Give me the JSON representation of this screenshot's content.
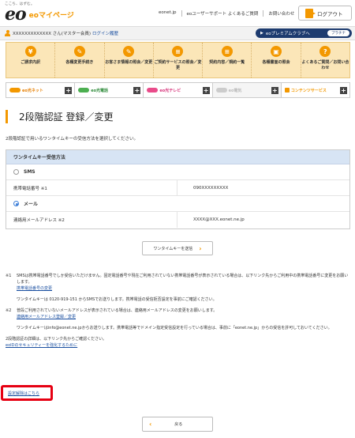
{
  "header": {
    "tagline": "ここち、はずむ。",
    "logo_text": "eo",
    "logo_sub": "eoマイページ",
    "links": [
      "eonet.jp",
      "eoユーザーサポート よくあるご質問",
      "お問い合わせ"
    ],
    "logout_label": "ログアウト"
  },
  "userbar": {
    "user_name": "XXXXXXXXXXXXX さん(マスター会員)",
    "history_link": "ログイン履歴",
    "premium_label": "eoプレミアムクラブへ",
    "premium_badge": "プラチナ"
  },
  "main_menu": [
    {
      "icon": "¥",
      "label": "ご請求内訳"
    },
    {
      "icon": "✎",
      "label": "各種変更手続き"
    },
    {
      "icon": "✎",
      "label": "お客さま情報の照会／変更"
    },
    {
      "icon": "≡",
      "label": "ご契約サービスの照会／変更"
    },
    {
      "icon": "≡",
      "label": "契約内容／規約一覧"
    },
    {
      "icon": "▣",
      "label": "各種書面の照会"
    },
    {
      "icon": "?",
      "label": "よくあるご質問／お問い合わせ"
    }
  ],
  "services": [
    {
      "label": "eo光ネット",
      "color": "#f39800",
      "text_color": "#e67e00"
    },
    {
      "label": "eo光電話",
      "color": "#4caf50",
      "text_color": "#2e8b3a"
    },
    {
      "label": "eo光テレビ",
      "color": "#e94b8a",
      "text_color": "#d6337a"
    },
    {
      "label": "eo電気",
      "color": "#cccccc",
      "text_color": "#bbbbbb"
    },
    {
      "label": "コンテンツサービス",
      "color": "#f39800",
      "text_color": "#f39800"
    }
  ],
  "page": {
    "title": "2段階認証 登録／変更",
    "intro": "2段階認証で用いるワンタイムキーの受信方法を選択してください。"
  },
  "form": {
    "heading": "ワンタイムキー受信方法",
    "sms_label": "SMS",
    "phone_label": "携帯電話番号 ※1",
    "phone_value": "090XXXXXXXXX",
    "mail_label": "メール",
    "email_label": "連絡用メールアドレス ※2",
    "email_value": "XXXX@XXX.eonet.ne.jp",
    "selected": "mail"
  },
  "send_button": "ワンタイムキーを送信",
  "notes": {
    "n1_mark": "※1",
    "n1_text": "SMSは携帯電話番号でしか受信いただけません。固定電話番号や現在ご利用されていない携帯電話番号が表示されている場合は、以下リンク先からご利用中の携帯電話番号に変更をお願いします。",
    "n1_link": "携帯電話番号の変更",
    "n1_extra": "ワンタイムキーは 0120-919-151 からSMSでお送りします。携帯電話の受信拒否設定を事前にご確認ください。",
    "n2_mark": "※2",
    "n2_text": "普段ご利用されていないメールアドレスが表示されている場合は、連絡用メールアドレスの変更をお願いします。",
    "n2_link": "連絡用メールアドレス登録／変更",
    "n2_extra": "ワンタイムキーはinfo@eonet.ne.jpからお送りします。携帯電話等でドメイン指定受信設定を行っている場合は、事前に「eonet.ne.jp」からの受信を許可しておいてください。",
    "detail_text": "2段階認証の詳細は、以下リンク先からご確認ください。",
    "detail_link": "eoIDのセキュリティーを強化するために"
  },
  "cancel_link": "設定解除はこちら",
  "back_button": "戻る"
}
